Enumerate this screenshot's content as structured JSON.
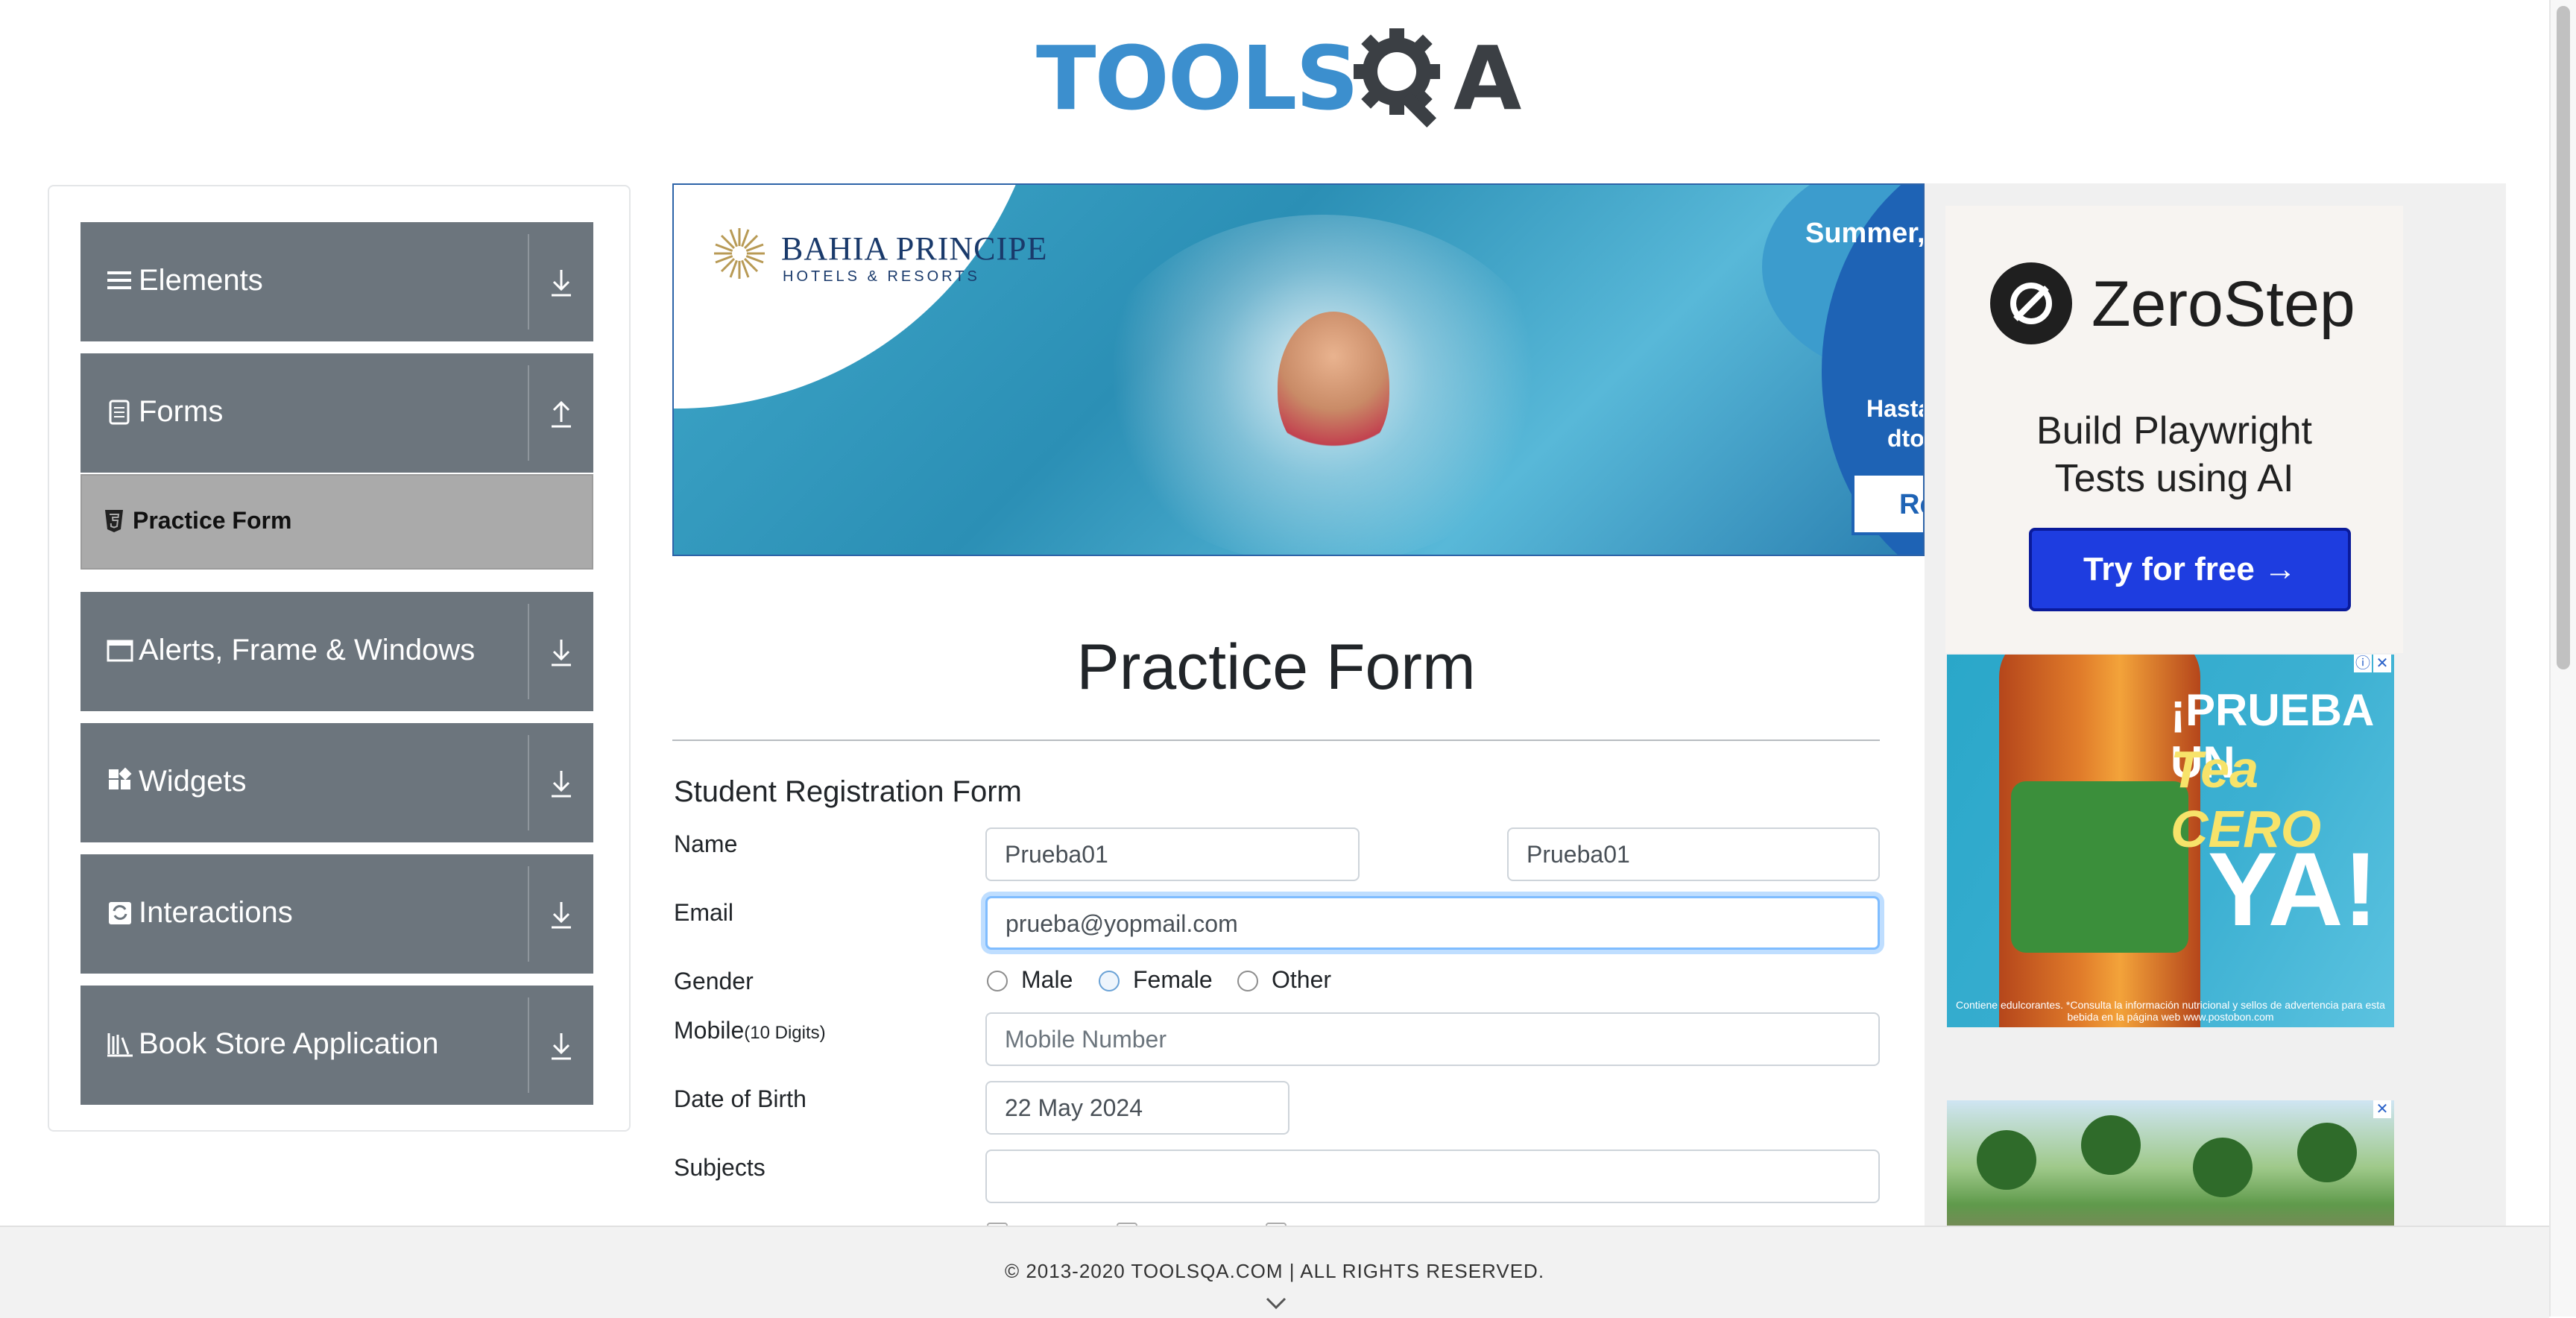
{
  "header": {
    "logo_tools": "TOOLS",
    "logo_qa": "QA"
  },
  "sidebar": {
    "groups": [
      {
        "label": "Elements",
        "icon": "list-icon",
        "arrow": "download"
      },
      {
        "label": "Forms",
        "icon": "document-icon",
        "arrow": "upload"
      },
      {
        "label": "Alerts, Frame & Windows",
        "icon": "window-icon",
        "arrow": "download"
      },
      {
        "label": "Widgets",
        "icon": "widgets-icon",
        "arrow": "download"
      },
      {
        "label": "Interactions",
        "icon": "interactions-icon",
        "arrow": "download"
      },
      {
        "label": "Book Store Application",
        "icon": "books-icon",
        "arrow": "download"
      }
    ],
    "active_item": {
      "label": "Practice Form",
      "icon": "html5-icon"
    }
  },
  "banner_ad": {
    "brand": "BAHIA PRINCIPE",
    "brand_sub": "HOTELS & RESORTS",
    "headline": "Summer,",
    "offer_line1": "Hasta",
    "offer_line2": "dto",
    "button": "Re"
  },
  "side_ads": {
    "zerostep": {
      "name": "ZeroStep",
      "tagline_1": "Build Playwright",
      "tagline_2": "Tests using AI",
      "button": "Try for free →"
    },
    "tea": {
      "line1": "¡PRUEBA UN",
      "line2": "Tea CERO",
      "line3": "YA!",
      "fine": "Contiene edulcorantes. *Consulta la información nutricional y sellos de advertencia para esta bebida en la página web www.postobon.com"
    }
  },
  "form": {
    "page_title": "Practice Form",
    "subtitle": "Student Registration Form",
    "name_label": "Name",
    "first_name": "Prueba01",
    "last_name": "Prueba01",
    "email_label": "Email",
    "email": "prueba@yopmail.com",
    "gender_label": "Gender",
    "gender_options": [
      "Male",
      "Female",
      "Other"
    ],
    "mobile_label": "Mobile",
    "mobile_hint": "(10 Digits)",
    "mobile_placeholder": "Mobile Number",
    "dob_label": "Date of Birth",
    "dob": "22 May 2024",
    "subjects_label": "Subjects",
    "subjects": ""
  },
  "footer": {
    "text": "© 2013-2020 TOOLSQA.COM | ALL RIGHTS RESERVED."
  }
}
